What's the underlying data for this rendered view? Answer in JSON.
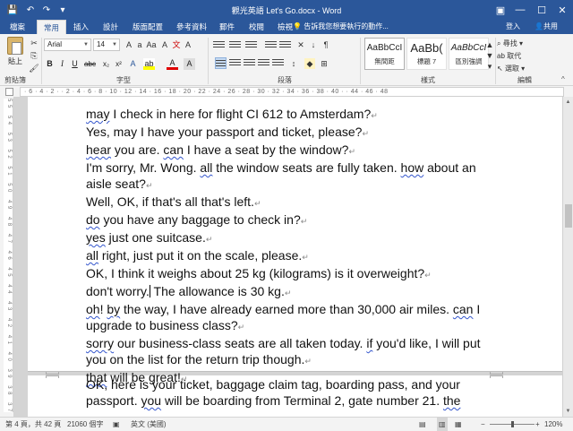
{
  "window": {
    "title": "觀光英語 Let's Go.docx - Word",
    "quick_access": {
      "save": "💾",
      "undo": "↶",
      "redo": "↷",
      "customize": "▾"
    },
    "controls": {
      "ribbon_options": "▣",
      "minimize": "—",
      "maximize": "☐",
      "close": "✕"
    }
  },
  "tabs": {
    "file": "檔案",
    "items": [
      "常用",
      "插入",
      "設計",
      "版面配置",
      "參考資料",
      "郵件",
      "校閱",
      "檢視"
    ],
    "active": "常用",
    "tell_me": "告訴我您想要執行的動作...",
    "sign_in": "登入",
    "share": "共用"
  },
  "ribbon": {
    "clipboard": {
      "paste": "貼上",
      "label": "剪貼簿"
    },
    "font": {
      "name": "Arial",
      "size": "14",
      "label": "字型",
      "buttons": [
        "B",
        "I",
        "U",
        "abc",
        "x₂",
        "x²",
        "A",
        "A"
      ]
    },
    "paragraph": {
      "label": "段落"
    },
    "styles": {
      "label": "樣式",
      "items": [
        {
          "sample": "AaBbCcI",
          "name": "無間距"
        },
        {
          "sample": "AaBb(",
          "name": "標題 7"
        },
        {
          "sample": "AaBbCcI",
          "name": "區別強調"
        }
      ]
    },
    "editing": {
      "label": "編輯",
      "find": "尋找",
      "replace": "取代",
      "select": "選取"
    },
    "collapse": "^"
  },
  "ruler": {
    "marks": "· 6 · 4 · 2 ·   · 2 · 4 · 6 · 8 · 10 · 12 · 14 · 16 · 18 · 20 · 22 · 24 · 26 · 28 · 30 · 32 · 34 · 36 · 38 · 40 ·   · 44 · 46 · 48"
  },
  "vertical_ruler": {
    "marks": "55 54 53 52 51 50 49 48 47 46 45 44 43 42 41 40 39 38 37 36 35 34 33 32 31 30"
  },
  "document": {
    "page1_lines": [
      {
        "sq": "may",
        "rest": " I check in here for flight CI 612 to Amsterdam?"
      },
      {
        "sq": "",
        "rest": "Yes, may I have your passport and ticket, please?"
      },
      {
        "sq": "hear",
        "rest": " you are. ",
        "sq2": "can",
        "rest2": " I have a seat by the window?"
      },
      {
        "sq": "",
        "rest": "I'm sorry, Mr. Wong. ",
        "sq2": "all",
        "rest2": " the window seats are fully taken. ",
        "sq3": "how",
        "rest3": " about an"
      },
      {
        "sq": "",
        "rest": "aisle seat?"
      },
      {
        "sq": "",
        "rest": "Well, OK, if that's all that's left."
      },
      {
        "sq": "do",
        "rest": " you have any baggage to check in?"
      },
      {
        "sq": "yes",
        "rest": " just one suitcase."
      },
      {
        "sq": "all",
        "rest": " right, just put it on the scale, please."
      },
      {
        "sq": "",
        "rest": "OK, I think it weighs about 25 kg (kilograms) is it overweight?"
      },
      {
        "sq": "",
        "rest": "don't worry.",
        "cursor": true,
        "rest2": " The allowance is 30 kg."
      },
      {
        "sq": "oh",
        "rest": "! ",
        "sq2": "by",
        "rest2": " the way, I have already earned more than 30,000 air miles. ",
        "sq3": "can",
        "rest3": " I"
      },
      {
        "sq": "",
        "rest": "upgrade to business class?"
      },
      {
        "sq": "sorry",
        "rest": " our business-class seats are all taken today. ",
        "sq2": "if",
        "rest2": " you'd like, I will put"
      },
      {
        "sq": "",
        "rest": "you on the list for the return trip though."
      },
      {
        "sq": "that",
        "rest": " will be great!"
      }
    ],
    "page2_lines": [
      {
        "sq": "",
        "rest": "OK, here is your ticket, baggage claim tag, boarding pass, and your"
      },
      {
        "sq": "",
        "rest": "passport. ",
        "sq2": "you",
        "rest2": " will be boarding from Terminal 2, gate number 21. ",
        "sq3": "the",
        "rest3": ""
      }
    ],
    "pilcrow": "↵"
  },
  "status": {
    "page": "第 4 頁，共 42 頁",
    "words": "21060 個字",
    "proof_icon": "▣",
    "language": "英文 (美國)",
    "zoom": "120%",
    "zoom_level": 0.5
  }
}
